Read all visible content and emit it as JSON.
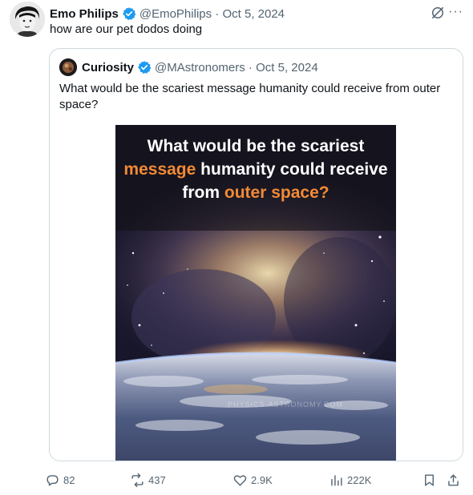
{
  "tweet": {
    "author_name": "Emo Philips",
    "author_handle": "@EmoPhilips",
    "date": "Oct 5, 2024",
    "text": "how are our pet dodos doing"
  },
  "quoted_tweet": {
    "author_name": "Curiosity",
    "author_handle": "@MAstronomers",
    "date": "Oct 5, 2024",
    "text": "What would be the scariest message humanity could receive from outer space?",
    "image": {
      "caption_parts": [
        "What would be the scariest ",
        "message",
        " humanity could receive from ",
        "outer space?"
      ],
      "watermark": "PHYSICS-ASTRONOMY.COM"
    }
  },
  "actions": {
    "replies": "82",
    "reposts": "437",
    "likes": "2.9K",
    "views": "222K"
  },
  "colors": {
    "verified": "#1d9bf0",
    "caption_highlight": "#f28a35",
    "muted_text": "#536471"
  }
}
